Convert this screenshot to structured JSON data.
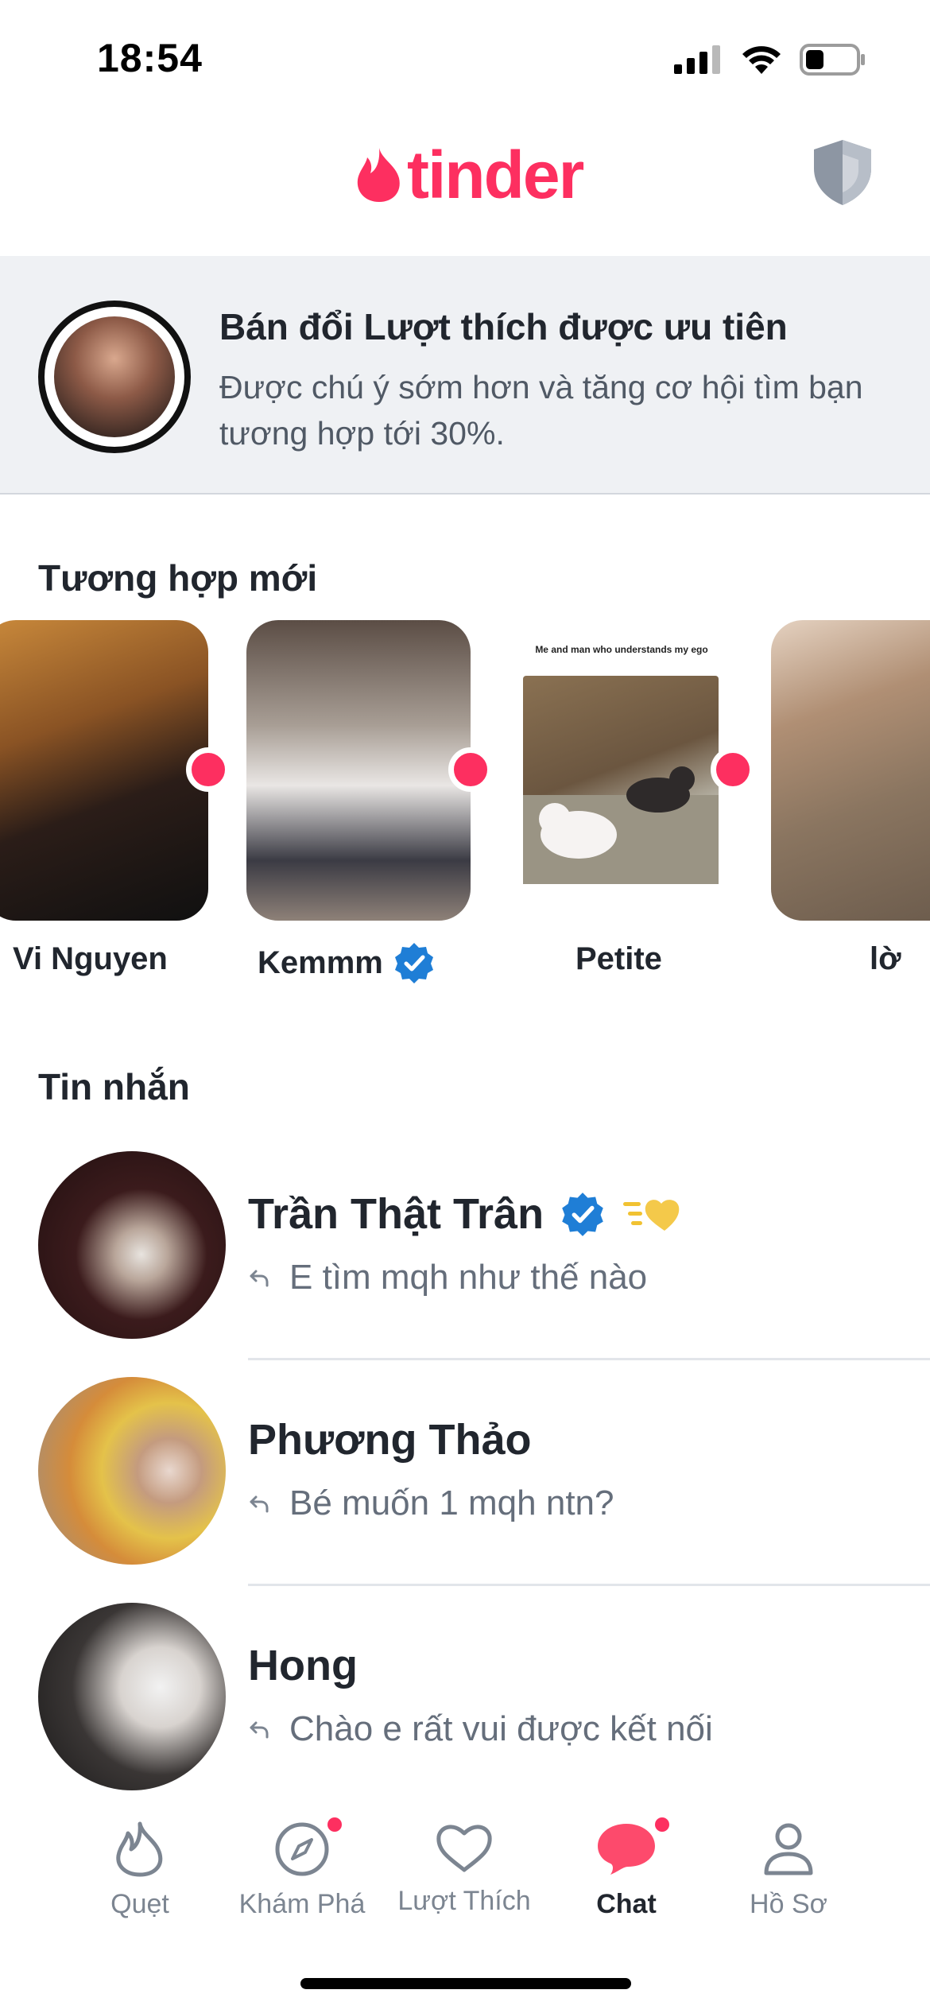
{
  "status_bar": {
    "time": "18:54"
  },
  "header": {
    "logo_text": "tinder",
    "brand_color": "#fd2f60"
  },
  "promo": {
    "title": "Bán đổi Lượt thích được ưu tiên",
    "description": "Được chú ý sớm hơn và tăng cơ hội tìm bạn tương hợp tới 30%."
  },
  "new_matches": {
    "title": "Tương hợp mới",
    "items": [
      {
        "name": "Vi Nguyen",
        "verified": false,
        "new": true
      },
      {
        "name": "Kemmm",
        "verified": true,
        "new": true
      },
      {
        "name": "Petite",
        "verified": false,
        "new": true,
        "meme_caption": "Me and man who understands my ego"
      },
      {
        "name": "lờ",
        "verified": false,
        "new": false
      }
    ]
  },
  "messages": {
    "title": "Tin nhắn",
    "items": [
      {
        "name": "Trần Thật Trân",
        "verified": true,
        "super_like": true,
        "preview": "E tìm mqh như thế nào"
      },
      {
        "name": "Phương Thảo",
        "verified": false,
        "super_like": false,
        "preview": "Bé muốn 1 mqh ntn?"
      },
      {
        "name": "Hong",
        "verified": false,
        "super_like": false,
        "preview": "Chào e rất vui được kết nối"
      }
    ]
  },
  "tab_bar": {
    "tabs": [
      {
        "label": "Quẹt",
        "icon": "flame-icon"
      },
      {
        "label": "Khám Phá",
        "icon": "compass-icon",
        "badge": true
      },
      {
        "label": "Lượt Thích",
        "icon": "heart-icon"
      },
      {
        "label": "Chat",
        "icon": "chat-bubble-icon",
        "badge": true,
        "active": true
      },
      {
        "label": "Hồ Sơ",
        "icon": "profile-icon"
      }
    ]
  }
}
